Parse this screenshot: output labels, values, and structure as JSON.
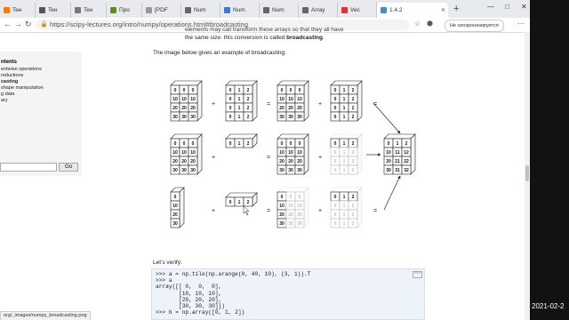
{
  "tabs": [
    {
      "label": "Teн"
    },
    {
      "label": "Teн"
    },
    {
      "label": "Teн"
    },
    {
      "label": "Про"
    },
    {
      "label": "[PDF"
    },
    {
      "label": "Num"
    },
    {
      "label": "Num"
    },
    {
      "label": "Num"
    },
    {
      "label": "Array"
    },
    {
      "label": "Vec"
    },
    {
      "label": "1.4.2"
    }
  ],
  "address": {
    "url": "https://scipy-lectures.org/intro/numpy/operations.html#broadcasting"
  },
  "profile_label": "Не синхронизируется",
  "sidebar": {
    "title": "ntents",
    "items": [
      {
        "label": "entwise operations",
        "bold": false
      },
      {
        "label": "reductions",
        "bold": false
      },
      {
        "label": "casting",
        "bold": true
      },
      {
        "label": "shape manipulation",
        "bold": false
      },
      {
        "label": "g data",
        "bold": false
      },
      {
        "label": "ary",
        "bold": false
      }
    ],
    "go_label": "Go"
  },
  "content": {
    "line1": "elements may call transform these arrays so that they all have",
    "line2_pre": "the same size: this conversion is called ",
    "line2_bold": "broadcasting",
    "line2_post": ".",
    "intro": "The image below gives an example of broadcasting:",
    "verify": "Let’s verify:"
  },
  "figure": {
    "a_full": [
      [
        "0",
        "0",
        "0"
      ],
      [
        "10",
        "10",
        "10"
      ],
      [
        "20",
        "20",
        "20"
      ],
      [
        "30",
        "30",
        "30"
      ]
    ],
    "b_full": [
      [
        "0",
        "1",
        "2"
      ],
      [
        "0",
        "1",
        "2"
      ],
      [
        "0",
        "1",
        "2"
      ],
      [
        "0",
        "1",
        "2"
      ]
    ],
    "b_row": [
      "0",
      "1",
      "2"
    ],
    "a_col": [
      "0",
      "10",
      "20",
      "30"
    ],
    "result": [
      [
        "0",
        "1",
        "2"
      ],
      [
        "10",
        "11",
        "12"
      ],
      [
        "20",
        "21",
        "22"
      ],
      [
        "30",
        "31",
        "32"
      ]
    ],
    "plus": "+",
    "equals": "="
  },
  "code": {
    "lines": [
      ">>> a = np.tile(np.arange(0, 40, 10), (3, 1)).T",
      ">>> a",
      "array([[ 0,  0,  0],",
      "       [10, 10, 10],",
      "       [20, 20, 20],",
      "       [30, 30, 30]])",
      ">>> b = np.array([0, 1, 2])"
    ],
    "copy_label": ">>>"
  },
  "status_url": "org/_images/numpy_broadcasting.png",
  "clock": "2021-02-2"
}
